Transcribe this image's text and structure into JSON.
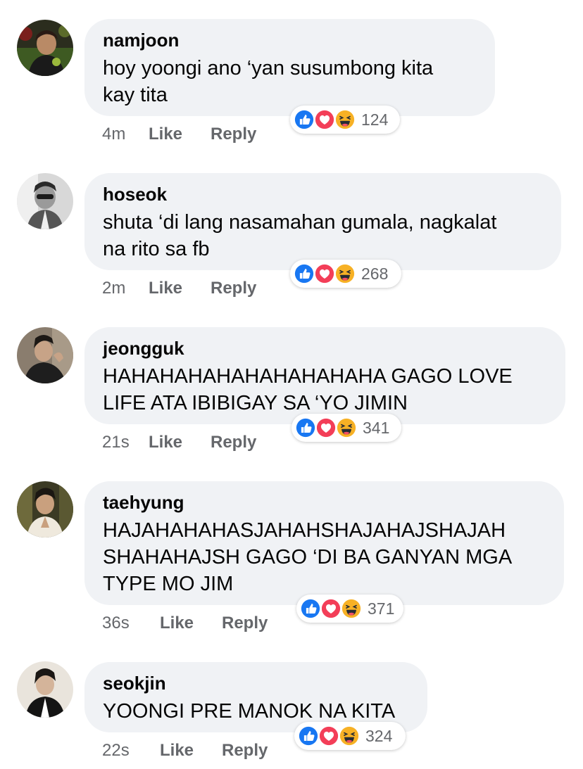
{
  "colors": {
    "bubble_bg": "#f0f2f5",
    "meta_text": "#65676b",
    "like_blue": "#1877f2",
    "love_red": "#f33e58",
    "haha_yellow": "#f7b125"
  },
  "reaction_icons": [
    "like-icon",
    "love-icon",
    "haha-icon"
  ],
  "comments": [
    {
      "name": "namjoon",
      "text": "hoy yoongi ano ‘yan susumbong kita\nkay tita",
      "time": "4m",
      "like_label": "Like",
      "reply_label": "Reply",
      "reaction_count": "124"
    },
    {
      "name": "hoseok",
      "text": "shuta ‘di lang nasamahan gumala, nagkalat\nna rito sa fb",
      "time": "2m",
      "like_label": "Like",
      "reply_label": "Reply",
      "reaction_count": "268"
    },
    {
      "name": "jeongguk",
      "text": "HAHAHAHAHAHAHAHAHAHA GAGO LOVE\nLIFE ATA IBIBIGAY SA ‘YO JIMIN",
      "time": "21s",
      "like_label": "Like",
      "reply_label": "Reply",
      "reaction_count": "341"
    },
    {
      "name": "taehyung",
      "text": "HAJAHAHAHASJAHAHSHAJAHAJSHAJAH\nSHAHAHAJSH GAGO ‘DI BA GANYAN MGA\nTYPE MO JIM",
      "time": "36s",
      "like_label": "Like",
      "reply_label": "Reply",
      "reaction_count": "371"
    },
    {
      "name": "seokjin",
      "text": "YOONGI PRE MANOK NA KITA",
      "time": "22s",
      "like_label": "Like",
      "reply_label": "Reply",
      "reaction_count": "324"
    }
  ]
}
